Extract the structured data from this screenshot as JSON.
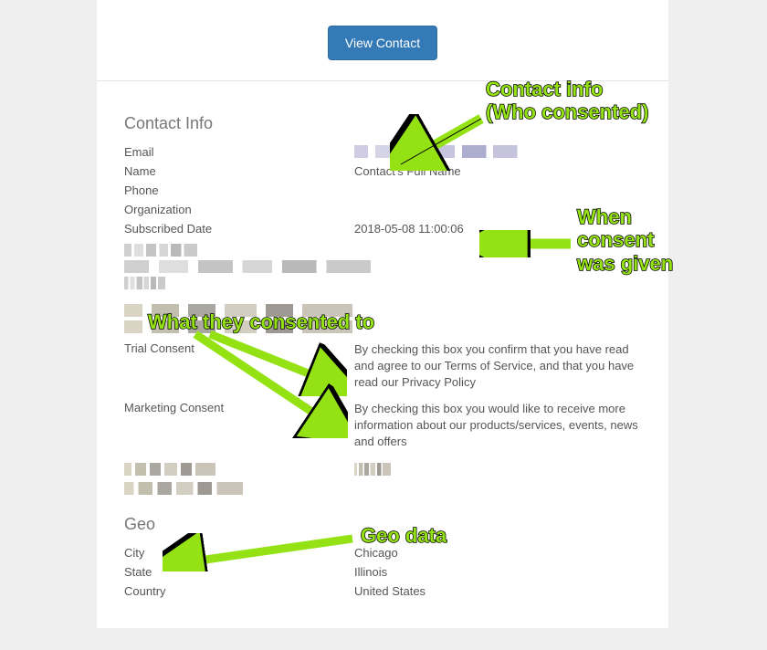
{
  "button": {
    "view_contact": "View Contact"
  },
  "sections": {
    "contact_info": {
      "heading": "Contact Info",
      "email_label": "Email",
      "name_label": "Name",
      "name_value": "Contact's Full Name",
      "phone_label": "Phone",
      "organization_label": "Organization",
      "subscribed_label": "Subscribed Date",
      "subscribed_value": "2018-05-08 11:00:06"
    },
    "consent": {
      "trial_label": "Trial Consent",
      "trial_value": "By checking this box you confirm that you have read and agree to our Terms of Service, and that you have read our Privacy Policy",
      "marketing_label": "Marketing Consent",
      "marketing_value": "By checking this box you would like to receive more information about our products/services, events, news and offers"
    },
    "geo": {
      "heading": "Geo",
      "city_label": "City",
      "city_value": "Chicago",
      "state_label": "State",
      "state_value": "Illinois",
      "country_label": "Country",
      "country_value": "United States"
    }
  },
  "annotations": {
    "contact_info": "Contact info\n(Who consented)",
    "when": "When\nconsent\nwas given",
    "what": "What they consented to",
    "geo": "Geo data"
  }
}
